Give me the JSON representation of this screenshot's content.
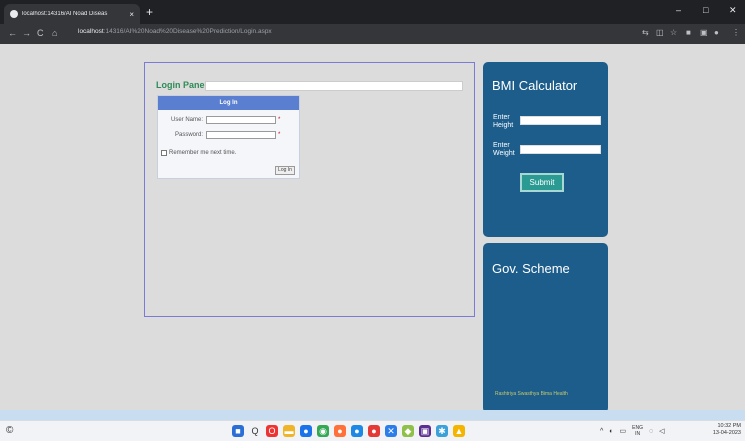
{
  "browser": {
    "tab_title": "localhost:14316/AI Noad Diseas",
    "tab_close": "×",
    "new_tab": "+",
    "url_host": "localhost",
    "url_path": ":14316/AI%20Noad%20Disease%20Prediction/Login.aspx",
    "back": "←",
    "forward": "→",
    "reload": "C",
    "home": "⌂",
    "win_min": "–",
    "win_max": "□",
    "win_close": "✕"
  },
  "login_panel": {
    "title": "Login Panel",
    "header": "Log In",
    "username_label": "User Name:",
    "password_label": "Password:",
    "required": "*",
    "remember": "Remember me next time.",
    "button": "Log In"
  },
  "bmi": {
    "title": "BMI Calculator",
    "height_label_1": "Enter",
    "height_label_2": "Height",
    "weight_label_1": "Enter",
    "weight_label_2": "Weight",
    "submit": "Submit"
  },
  "gov": {
    "title": "Gov. Scheme",
    "footer": "Rashtriya Swasthya Bima Health"
  },
  "taskbar": {
    "search": "Q",
    "tray_lang_1": "ENG",
    "tray_lang_2": "IN",
    "time": "10:32 PM",
    "date": "13-04-2023"
  },
  "colors": {
    "card_bg": "#1c5d8c",
    "panel_title": "#2e8b57",
    "login_head": "#5b7fd0",
    "submit_bg": "#2a9a93"
  }
}
